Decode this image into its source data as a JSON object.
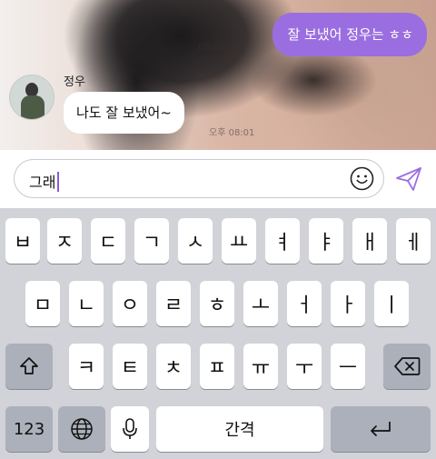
{
  "chat": {
    "sent_message": "잘 보냈어 정우는 ㅎㅎ",
    "sent_time": "08:01",
    "sender_name": "정우",
    "received_message": "나도 잘 보냈어~",
    "received_time": "오후 08:01"
  },
  "input": {
    "text": "그래",
    "emoji_icon": "smiley-icon",
    "send_icon": "paper-plane-icon"
  },
  "keyboard": {
    "row1": [
      "ㅂ",
      "ㅈ",
      "ㄷ",
      "ㄱ",
      "ㅅ",
      "ㅛ",
      "ㅕ",
      "ㅑ",
      "ㅐ",
      "ㅔ"
    ],
    "row2": [
      "ㅁ",
      "ㄴ",
      "ㅇ",
      "ㄹ",
      "ㅎ",
      "ㅗ",
      "ㅓ",
      "ㅏ",
      "ㅣ"
    ],
    "row3": [
      "ㅋ",
      "ㅌ",
      "ㅊ",
      "ㅍ",
      "ㅠ",
      "ㅜ",
      "ㅡ"
    ],
    "numbers_label": "123",
    "space_label": "간격",
    "shift_icon": "shift-icon",
    "delete_icon": "backspace-icon",
    "globe_icon": "globe-icon",
    "mic_icon": "microphone-icon",
    "return_icon": "return-icon"
  },
  "colors": {
    "accent": "#9a6ee0",
    "caret": "#8a5cd6",
    "key_bg": "#ffffff",
    "func_key_bg": "#abb0ba",
    "keyboard_bg": "#d1d3d9"
  }
}
